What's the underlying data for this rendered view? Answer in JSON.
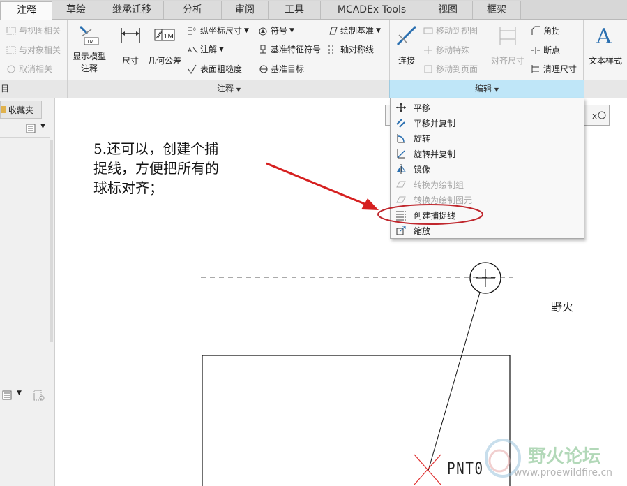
{
  "tabs": [
    "注释",
    "草绘",
    "继承迁移",
    "分析",
    "审阅",
    "工具",
    "MCADEx Tools",
    "视图",
    "框架"
  ],
  "ribbon": {
    "left_col": {
      "items": [
        "与视图相关",
        "与对象相关",
        "取消相关"
      ]
    },
    "show_model_annotation": [
      "显示模型",
      "注释"
    ],
    "dimension": "尺寸",
    "geo_tolerance": "几何公差",
    "ordinate": "纵坐标尺寸",
    "note": "注解",
    "surface_finish": "表面粗糙度",
    "symbol": "符号",
    "datum_feature_symbol": "基准特征符号",
    "datum_target": "基准目标",
    "draw_datum": "绘制基准",
    "axis_symmetry": "轴对称线",
    "connect": "连接",
    "move_to_view": "移动到视图",
    "move_special": "移动特殊",
    "move_to_page": "移动到页面",
    "align_dim": "对齐尺寸",
    "corner": "角拐",
    "breakpoint": "断点",
    "cleanup_dim": "清理尺寸",
    "text_style": "文本样式",
    "group_left": "目",
    "group_annot": "注释",
    "group_edit": "编辑"
  },
  "left_panel": {
    "favorites": "收藏夹"
  },
  "menu": {
    "items": [
      {
        "label": "平移",
        "icon": "move-icon",
        "enabled": true
      },
      {
        "label": "平移并复制",
        "icon": "move-copy-icon",
        "enabled": true
      },
      {
        "label": "旋转",
        "icon": "rotate-icon",
        "enabled": true
      },
      {
        "label": "旋转并复制",
        "icon": "rotate-copy-icon",
        "enabled": true
      },
      {
        "label": "镜像",
        "icon": "mirror-icon",
        "enabled": true
      },
      {
        "label": "转换为绘制组",
        "icon": "convert-group-icon",
        "enabled": false
      },
      {
        "label": "转换为绘制图元",
        "icon": "convert-entity-icon",
        "enabled": false
      },
      {
        "label": "创建捕捉线",
        "icon": "snap-line-icon",
        "enabled": true
      },
      {
        "label": "缩放",
        "icon": "scale-icon",
        "enabled": true
      }
    ]
  },
  "annotation": {
    "line1": "5.还可以，创建个捕",
    "line2": "捉线，方便把所有的",
    "line3": "球标对齐；"
  },
  "canvas": {
    "wild_fire_text": "野火",
    "pnt_label": "PNT0"
  },
  "watermark": {
    "title": "野火论坛",
    "url": "www.proewildfire.cn"
  },
  "colors": {
    "accent": "#cce8f6",
    "highlight_oval": "#c0272d",
    "arrow": "#d62020"
  }
}
